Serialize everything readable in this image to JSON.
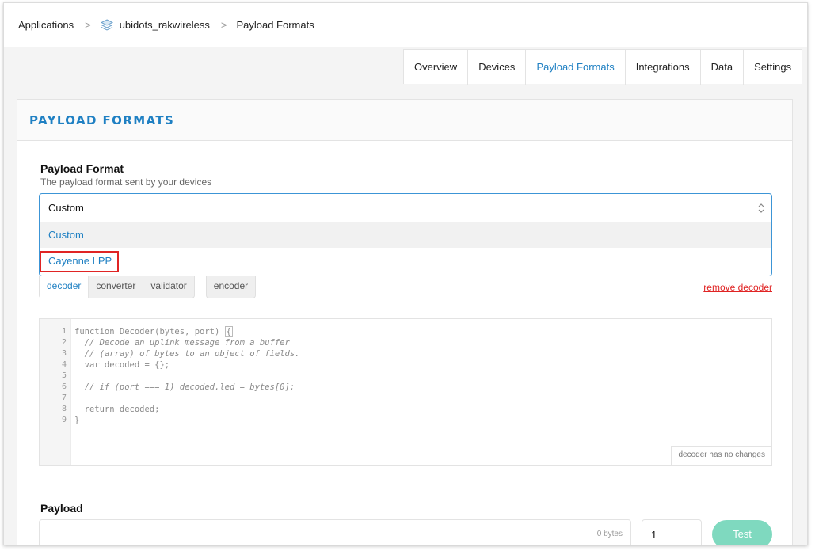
{
  "breadcrumb": {
    "applications": "Applications",
    "app_name": "ubidots_rakwireless",
    "current": "Payload Formats",
    "app_icon": "stack-icon"
  },
  "tabs": [
    {
      "label": "Overview"
    },
    {
      "label": "Devices"
    },
    {
      "label": "Payload Formats",
      "active": true
    },
    {
      "label": "Integrations"
    },
    {
      "label": "Data"
    },
    {
      "label": "Settings"
    }
  ],
  "card": {
    "title": "PAYLOAD FORMATS",
    "field_label": "Payload Format",
    "field_desc": "The payload format sent by your devices",
    "select_value": "Custom",
    "options": [
      "Custom",
      "Cayenne LPP"
    ]
  },
  "subtabs": {
    "group1": [
      "decoder",
      "converter",
      "validator"
    ],
    "group2": [
      "encoder"
    ],
    "remove": "remove decoder"
  },
  "editor": {
    "lines": [
      "function Decoder(bytes, port) {",
      "  // Decode an uplink message from a buffer",
      "  // (array) of bytes to an object of fields.",
      "  var decoded = {};",
      "",
      "  // if (port === 1) decoded.led = bytes[0];",
      "",
      "  return decoded;",
      "}"
    ],
    "status": "decoder has no changes"
  },
  "payload": {
    "label": "Payload",
    "bytes": "0 bytes",
    "port": "1",
    "test_label": "Test"
  },
  "colors": {
    "accent": "#1f80c3",
    "highlight": "#e02424",
    "test_button": "#7fd9bf"
  }
}
